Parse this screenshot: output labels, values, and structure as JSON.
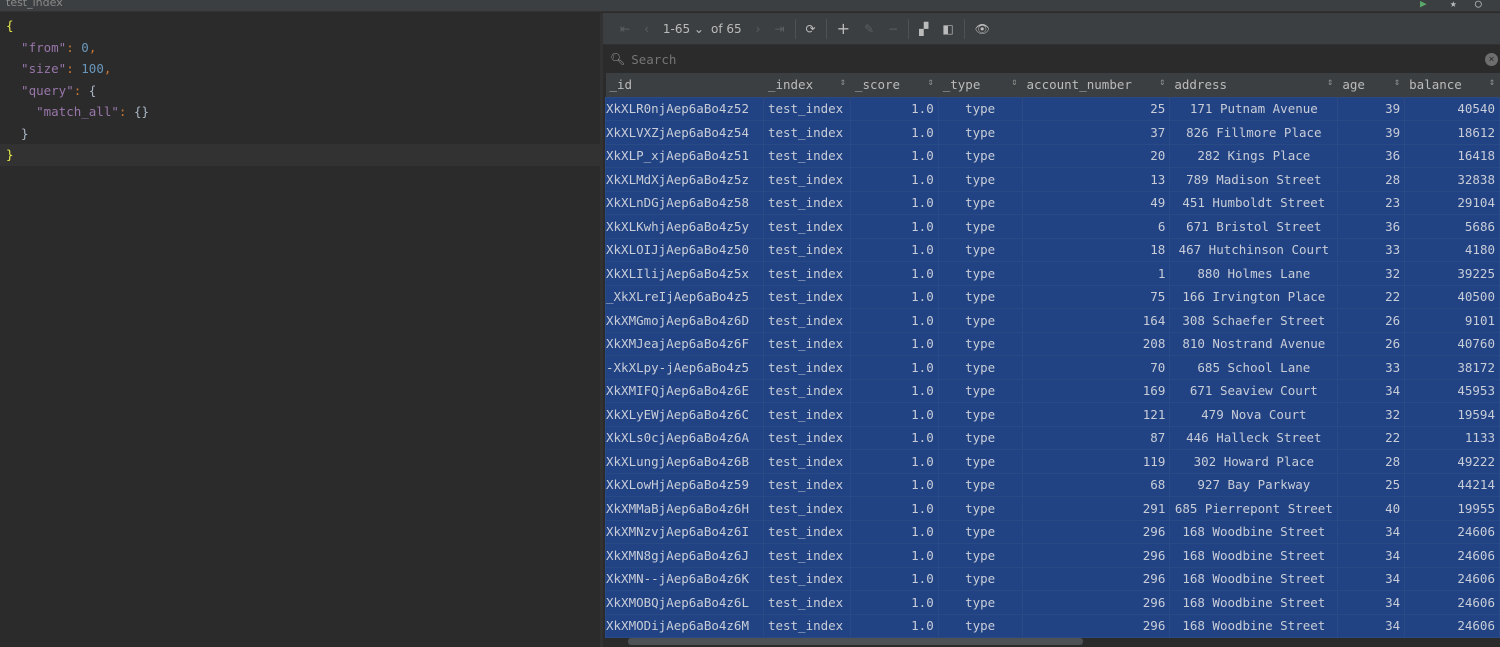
{
  "window": {
    "tab_title": "test_index"
  },
  "editor": {
    "lines": [
      {
        "parts": [
          [
            "y",
            "{"
          ]
        ]
      },
      {
        "parts": [
          [
            "k",
            "  \"from\""
          ],
          [
            "p",
            ": "
          ],
          [
            "n",
            "0"
          ],
          [
            "p",
            ","
          ]
        ]
      },
      {
        "parts": [
          [
            "k",
            "  \"size\""
          ],
          [
            "p",
            ": "
          ],
          [
            "n",
            "100"
          ],
          [
            "p",
            ","
          ]
        ]
      },
      {
        "parts": [
          [
            "k",
            "  \"query\""
          ],
          [
            "p",
            ": "
          ],
          [
            "b",
            "{"
          ]
        ]
      },
      {
        "parts": [
          [
            "k",
            "    \"match_all\""
          ],
          [
            "p",
            ": "
          ],
          [
            "b",
            "{}"
          ]
        ]
      },
      {
        "parts": [
          [
            "b",
            "  }"
          ]
        ]
      },
      {
        "parts": [
          [
            "y",
            "}"
          ]
        ]
      }
    ]
  },
  "toolbar": {
    "first": "⇤",
    "prev": "‹",
    "range": "1-65 ⌄",
    "of": "of 65",
    "next": "›",
    "last": "⇥",
    "refresh": "⟳",
    "add": "+",
    "edit": "✎",
    "remove": "−",
    "layout": "▞",
    "panel": "◧",
    "view": "👁"
  },
  "search": {
    "placeholder": "Search",
    "icon": "search-icon"
  },
  "table": {
    "columns": [
      "_id",
      "_index",
      "_score",
      "_type",
      "account_number",
      "address",
      "age",
      "balance"
    ],
    "rows": [
      [
        "XkXLR0njAep6aBo4z52",
        "test_index",
        "1.0",
        "type",
        "25",
        "171 Putnam Avenue",
        "39",
        "40540"
      ],
      [
        "XkXLVXZjAep6aBo4z54",
        "test_index",
        "1.0",
        "type",
        "37",
        "826 Fillmore Place",
        "39",
        "18612"
      ],
      [
        "XkXLP_xjAep6aBo4z51",
        "test_index",
        "1.0",
        "type",
        "20",
        "282 Kings Place",
        "36",
        "16418"
      ],
      [
        "XkXLMdXjAep6aBo4z5z",
        "test_index",
        "1.0",
        "type",
        "13",
        "789 Madison Street",
        "28",
        "32838"
      ],
      [
        "XkXLnDGjAep6aBo4z58",
        "test_index",
        "1.0",
        "type",
        "49",
        "451 Humboldt Street",
        "23",
        "29104"
      ],
      [
        "XkXLKwhjAep6aBo4z5y",
        "test_index",
        "1.0",
        "type",
        "6",
        "671 Bristol Street",
        "36",
        "5686"
      ],
      [
        "XkXLOIJjAep6aBo4z50",
        "test_index",
        "1.0",
        "type",
        "18",
        "467 Hutchinson Court",
        "33",
        "4180"
      ],
      [
        "XkXLIlijAep6aBo4z5x",
        "test_index",
        "1.0",
        "type",
        "1",
        "880 Holmes Lane",
        "32",
        "39225"
      ],
      [
        "XkXLreIjAep6aBo4z5_",
        "test_index",
        "1.0",
        "type",
        "75",
        "166 Irvington Place",
        "22",
        "40500"
      ],
      [
        "XkXMGmojAep6aBo4z6D",
        "test_index",
        "1.0",
        "type",
        "164",
        "308 Schaefer Street",
        "26",
        "9101"
      ],
      [
        "XkXMJeajAep6aBo4z6F",
        "test_index",
        "1.0",
        "type",
        "208",
        "810 Nostrand Avenue",
        "26",
        "40760"
      ],
      [
        "XkXLpy-jAep6aBo4z5-",
        "test_index",
        "1.0",
        "type",
        "70",
        "685 School Lane",
        "33",
        "38172"
      ],
      [
        "XkXMIFQjAep6aBo4z6E",
        "test_index",
        "1.0",
        "type",
        "169",
        "671 Seaview Court",
        "34",
        "45953"
      ],
      [
        "XkXLyEWjAep6aBo4z6C",
        "test_index",
        "1.0",
        "type",
        "121",
        "479 Nova Court",
        "32",
        "19594"
      ],
      [
        "XkXLs0cjAep6aBo4z6A",
        "test_index",
        "1.0",
        "type",
        "87",
        "446 Halleck Street",
        "22",
        "1133"
      ],
      [
        "XkXLungjAep6aBo4z6B",
        "test_index",
        "1.0",
        "type",
        "119",
        "302 Howard Place",
        "28",
        "49222"
      ],
      [
        "XkXLowHjAep6aBo4z59",
        "test_index",
        "1.0",
        "type",
        "68",
        "927 Bay Parkway",
        "25",
        "44214"
      ],
      [
        "XkXMMaBjAep6aBo4z6H",
        "test_index",
        "1.0",
        "type",
        "291",
        "685 Pierrepont Street",
        "40",
        "19955"
      ],
      [
        "XkXMNzvjAep6aBo4z6I",
        "test_index",
        "1.0",
        "type",
        "296",
        "168 Woodbine Street",
        "34",
        "24606"
      ],
      [
        "XkXMN8gjAep6aBo4z6J",
        "test_index",
        "1.0",
        "type",
        "296",
        "168 Woodbine Street",
        "34",
        "24606"
      ],
      [
        "XkXMN--jAep6aBo4z6K",
        "test_index",
        "1.0",
        "type",
        "296",
        "168 Woodbine Street",
        "34",
        "24606"
      ],
      [
        "XkXMOBQjAep6aBo4z6L",
        "test_index",
        "1.0",
        "type",
        "296",
        "168 Woodbine Street",
        "34",
        "24606"
      ],
      [
        "XkXMODijAep6aBo4z6M",
        "test_index",
        "1.0",
        "type",
        "296",
        "168 Woodbine Street",
        "34",
        "24606"
      ]
    ]
  },
  "colors": {
    "selection": "#214283",
    "background": "#2b2b2b",
    "toolbar": "#3c3f41"
  }
}
